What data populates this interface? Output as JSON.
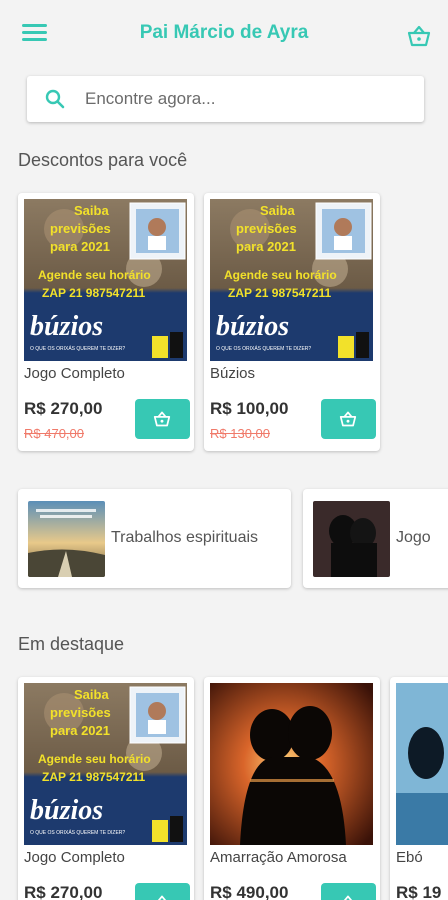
{
  "header": {
    "title": "Pai Márcio de Ayra",
    "menu_icon": "menu-icon",
    "cart_icon": "basket-icon"
  },
  "search": {
    "placeholder": "Encontre agora..."
  },
  "discounts": {
    "title": "Descontos para você",
    "items": [
      {
        "name": "Jogo Completo",
        "price": "R$ 270,00",
        "old_price": "R$ 470,00"
      },
      {
        "name": "Búzios",
        "price": "R$ 100,00",
        "old_price": "R$ 130,00"
      }
    ]
  },
  "banner_text": {
    "line1": "Saiba",
    "line2": "previsões",
    "line3": "para 2021",
    "line4": "Agende seu horário",
    "line5": "ZAP 21 987547211",
    "brand": "búzios",
    "tagline": "O QUE OS ORIXÁS QUEREM TE DIZER?"
  },
  "categories": {
    "items": [
      {
        "label": "Trabalhos espirituais"
      },
      {
        "label": "Jogo"
      }
    ]
  },
  "featured": {
    "title": "Em destaque",
    "items": [
      {
        "name": "Jogo Completo",
        "price": "R$ 270,00"
      },
      {
        "name": "Amarração Amorosa",
        "price": "R$ 490,00"
      },
      {
        "name": "Ebó",
        "price": "R$ 19"
      }
    ]
  },
  "colors": {
    "accent": "#37c8b4",
    "old_price": "#f07a6a",
    "banner_text": "#f2e12a",
    "banner_bg": "#1d3a6e"
  }
}
